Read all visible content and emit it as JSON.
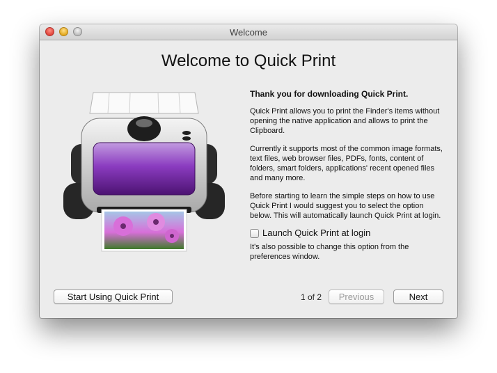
{
  "window": {
    "title": "Welcome"
  },
  "main": {
    "heading": "Welcome to Quick Print",
    "intro_bold": "Thank you for downloading Quick Print.",
    "paragraphs": [
      "Quick Print allows you to print the Finder's items without opening the native application and allows to print the Clipboard.",
      "Currently it supports most of the common image formats, text files, web browser files, PDFs, fonts, content of folders, smart folders, applications' recent opened files and many more.",
      "Before starting to learn the simple steps on how to use Quick Print I would suggest you to select the option below. This will automatically launch Quick Print at login."
    ],
    "checkbox": {
      "label": "Launch Quick Print at login",
      "checked": false
    },
    "footnote": "It's also possible to change this option from the preferences window."
  },
  "footer": {
    "start_button": "Start Using Quick Print",
    "page_indicator": "1 of 2",
    "previous_button": "Previous",
    "next_button": "Next"
  },
  "icons": [
    "close-icon",
    "minimize-icon",
    "zoom-icon",
    "printer-icon"
  ],
  "colors": {
    "printer_accent": "#7b2fa8",
    "flower": "#d86fd9",
    "foliage": "#3f7a2a"
  }
}
